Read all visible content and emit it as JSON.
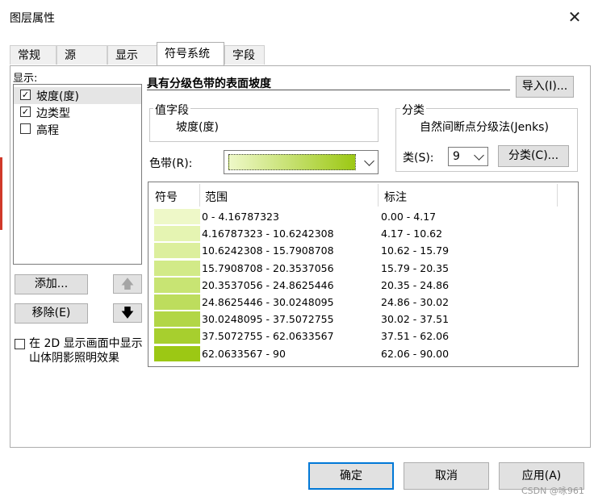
{
  "window": {
    "title": "图层属性",
    "close_glyph": "✕"
  },
  "tabs": [
    {
      "label": "常规",
      "active": false
    },
    {
      "label": "源",
      "active": false
    },
    {
      "label": "显示",
      "active": false
    },
    {
      "label": "符号系统",
      "active": true
    },
    {
      "label": "字段",
      "active": false
    }
  ],
  "left_panel": {
    "show_label": "显示:",
    "items": [
      {
        "label": "坡度(度)",
        "checked": true,
        "selected": true
      },
      {
        "label": "边类型",
        "checked": true,
        "selected": false
      },
      {
        "label": "高程",
        "checked": false,
        "selected": false
      }
    ],
    "add_button": "添加...",
    "remove_button": "移除(E)",
    "up_icon": "arrow-up-icon",
    "down_icon": "arrow-down-icon",
    "hillshade_checkbox_label": "在 2D 显示画面中显示山体阴影照明效果",
    "hillshade_checked": false
  },
  "renderer": {
    "title": "具有分级色带的表面坡度",
    "import_button": "导入(I)...",
    "value_field_group": "值字段",
    "value_field": "坡度(度)",
    "classification_group": "分类",
    "method": "自然间断点分级法(Jenks)",
    "classes_label": "类(S):",
    "classes_value": "9",
    "classify_button": "分类(C)...",
    "color_ramp_label": "色带(R):",
    "color_ramp_colors": [
      "#eef8c8",
      "#9cc814"
    ]
  },
  "table": {
    "headers": {
      "symbol": "符号",
      "range": "范围",
      "label": "标注"
    },
    "rows": [
      {
        "color": "#eef8c8",
        "range": "0 - 4.16787323",
        "label": "0.00 - 4.17"
      },
      {
        "color": "#e5f4b2",
        "range": "4.16787323 - 10.6242308",
        "label": "4.17 - 10.62"
      },
      {
        "color": "#dcef9d",
        "range": "10.6242308 - 15.7908708",
        "label": "10.62 - 15.79"
      },
      {
        "color": "#d2ea88",
        "range": "15.7908708 - 20.3537056",
        "label": "15.79 - 20.35"
      },
      {
        "color": "#c8e473",
        "range": "20.3537056 - 24.8625446",
        "label": "20.35 - 24.86"
      },
      {
        "color": "#bddd5d",
        "range": "24.8625446 - 30.0248095",
        "label": "24.86 - 30.02"
      },
      {
        "color": "#b2d646",
        "range": "30.0248095 - 37.5072755",
        "label": "30.02 - 37.51"
      },
      {
        "color": "#a7cf2e",
        "range": "37.5072755 - 62.0633567",
        "label": "37.51 - 62.06"
      },
      {
        "color": "#9cc814",
        "range": "62.0633567 - 90",
        "label": "62.06 - 90.00"
      }
    ]
  },
  "footer": {
    "ok": "确定",
    "cancel": "取消",
    "apply": "应用(A)"
  },
  "watermark": "CSDN @咏961"
}
